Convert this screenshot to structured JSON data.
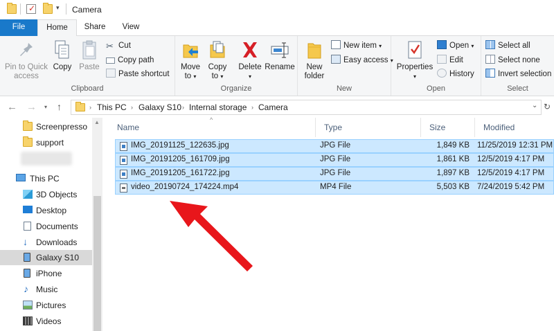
{
  "window": {
    "title": "Camera"
  },
  "tabs": {
    "file": "File",
    "home": "Home",
    "share": "Share",
    "view": "View"
  },
  "ribbon": {
    "clipboard": {
      "label": "Clipboard",
      "pin_line1": "Pin to Quick",
      "pin_line2": "access",
      "copy": "Copy",
      "paste": "Paste",
      "cut": "Cut",
      "copy_path": "Copy path",
      "paste_shortcut": "Paste shortcut"
    },
    "organize": {
      "label": "Organize",
      "move_line1": "Move",
      "move_line2": "to",
      "copy_line1": "Copy",
      "copy_line2": "to",
      "delete": "Delete",
      "rename": "Rename"
    },
    "new": {
      "label": "New",
      "new_folder_line1": "New",
      "new_folder_line2": "folder",
      "new_item": "New item",
      "easy_access": "Easy access"
    },
    "open": {
      "label": "Open",
      "properties": "Properties",
      "open": "Open",
      "edit": "Edit",
      "history": "History"
    },
    "select": {
      "label": "Select",
      "select_all": "Select all",
      "select_none": "Select none",
      "invert_selection": "Invert selection"
    }
  },
  "address": {
    "crumbs": [
      "This PC",
      "Galaxy S10",
      "Internal storage",
      "Camera"
    ]
  },
  "nav": {
    "items": [
      {
        "label": "Screenpresso",
        "icon": "folder-icon"
      },
      {
        "label": "support",
        "icon": "folder-icon"
      },
      {
        "label": "This PC",
        "icon": "computer-icon"
      },
      {
        "label": "3D Objects",
        "icon": "cube-icon"
      },
      {
        "label": "Desktop",
        "icon": "desktop-icon"
      },
      {
        "label": "Documents",
        "icon": "documents-icon"
      },
      {
        "label": "Downloads",
        "icon": "download-icon"
      },
      {
        "label": "Galaxy S10",
        "icon": "phone-icon"
      },
      {
        "label": "iPhone",
        "icon": "phone-icon"
      },
      {
        "label": "Music",
        "icon": "music-note-icon"
      },
      {
        "label": "Pictures",
        "icon": "pictures-icon"
      },
      {
        "label": "Videos",
        "icon": "video-icon"
      }
    ]
  },
  "columns": {
    "name": "Name",
    "type": "Type",
    "size": "Size",
    "modified": "Modified"
  },
  "files": [
    {
      "name": "IMG_20191125_122635.jpg",
      "type": "JPG File",
      "size": "1,849 KB",
      "modified": "11/25/2019 12:31 PM"
    },
    {
      "name": "IMG_20191205_161709.jpg",
      "type": "JPG File",
      "size": "1,861 KB",
      "modified": "12/5/2019 4:17 PM"
    },
    {
      "name": "IMG_20191205_161722.jpg",
      "type": "JPG File",
      "size": "1,897 KB",
      "modified": "12/5/2019 4:17 PM"
    },
    {
      "name": "video_20190724_174224.mp4",
      "type": "MP4 File",
      "size": "5,503 KB",
      "modified": "7/24/2019 5:42 PM"
    }
  ],
  "colors": {
    "accent": "#1979ca",
    "selection": "#cce8ff",
    "annotation_arrow": "#e8161b"
  }
}
